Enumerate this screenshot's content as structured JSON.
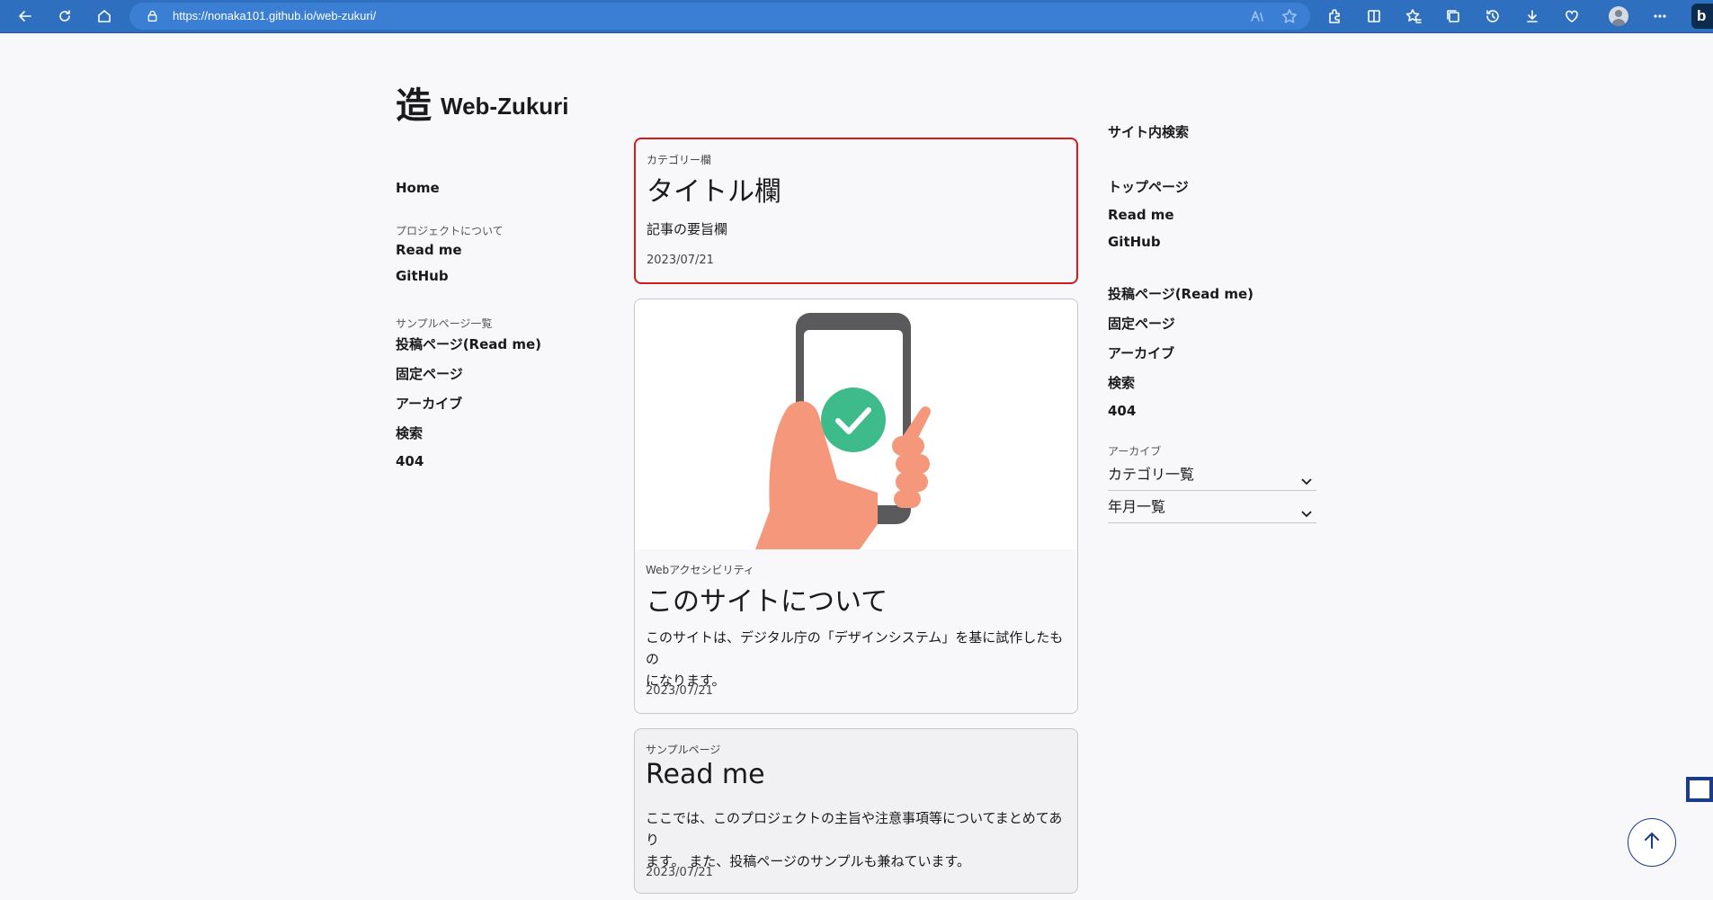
{
  "browser": {
    "url": "https://nonaka101.github.io/web-zukuri/",
    "icons": [
      "back-icon",
      "refresh-icon",
      "home-icon",
      "lock-icon",
      "read-aloud-icon",
      "favorite-star-icon",
      "extensions-icon",
      "split-screen-icon",
      "favorites-icon",
      "collections-icon",
      "history-icon",
      "downloads-icon",
      "performance-icon",
      "profile-icon",
      "more-icon",
      "bing-icon"
    ]
  },
  "site": {
    "logo_mark": "造",
    "logo_name": "Web-Zukuri"
  },
  "leftnav": {
    "home": "Home",
    "section1_caption": "プロジェクトについて",
    "section1_items": [
      "Read me",
      "GitHub"
    ],
    "section2_caption": "サンプルページ一覧",
    "section2_items": [
      "投稿ページ(Read me)",
      "固定ページ",
      "アーカイブ",
      "検索",
      "404"
    ]
  },
  "cards": [
    {
      "category": "カテゴリー欄",
      "title": "タイトル欄",
      "summary": "記事の要旨欄",
      "date": "2023/07/21"
    },
    {
      "category": "Webアクセシビリティ",
      "title": "このサイトについて",
      "summary_line1": "このサイトは、デジタル庁の「デザインシステム」を基に試作したもの",
      "summary_line2": "になります。",
      "date": "2023/07/21"
    },
    {
      "category": "サンプルページ",
      "title": "Read me",
      "summary_line1": "ここでは、このプロジェクトの主旨や注意事項等についてまとめてあり",
      "summary_line2": "ます。 また、投稿ページのサンプルも兼ねています。",
      "date": "2023/07/21"
    }
  ],
  "rightnav": {
    "search_title": "サイト内検索",
    "group1": [
      "トップページ",
      "Read me",
      "GitHub"
    ],
    "group2": [
      "投稿ページ(Read me)",
      "固定ページ",
      "アーカイブ",
      "検索",
      "404"
    ],
    "archive_caption": "アーカイブ",
    "accordions": [
      "カテゴリ一覧",
      "年月一覧"
    ]
  },
  "colors": {
    "chrome_bar": "#2f6fbf",
    "focus_border": "#d61a1a",
    "check_green": "#3dbb8a",
    "hand_skin": "#f4977a",
    "phone_gray": "#5a5a5c"
  }
}
